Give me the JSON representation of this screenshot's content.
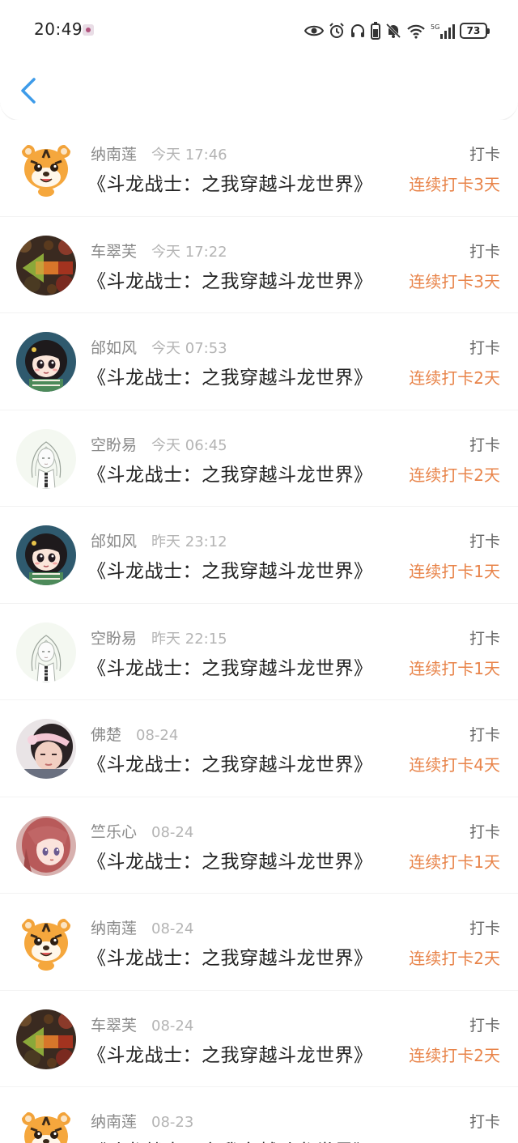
{
  "status": {
    "time": "20:49",
    "battery": "73"
  },
  "header": {
    "back_icon": "chevron-left-icon",
    "accent_color": "#3d9be9"
  },
  "colors": {
    "streak": "#e8844a",
    "name": "#8a8a8a",
    "time": "#b4b4b4",
    "title": "#222222"
  },
  "records": [
    {
      "name": "纳南莲",
      "time": "今天 17:46",
      "book": "《斗龙战士：之我穿越斗龙世界》",
      "type": "打卡",
      "streak": "连续打卡3天",
      "avatar": "tiger"
    },
    {
      "name": "车翠芙",
      "time": "今天 17:22",
      "book": "《斗龙战士：之我穿越斗龙世界》",
      "type": "打卡",
      "streak": "连续打卡3天",
      "avatar": "leaves"
    },
    {
      "name": "邰如风",
      "time": "今天 07:53",
      "book": "《斗龙战士：之我穿越斗龙世界》",
      "type": "打卡",
      "streak": "连续打卡2天",
      "avatar": "girl-dark"
    },
    {
      "name": "空盼易",
      "time": "今天 06:45",
      "book": "《斗龙战士：之我穿越斗龙世界》",
      "type": "打卡",
      "streak": "连续打卡2天",
      "avatar": "sketch-girl"
    },
    {
      "name": "邰如风",
      "time": "昨天 23:12",
      "book": "《斗龙战士：之我穿越斗龙世界》",
      "type": "打卡",
      "streak": "连续打卡1天",
      "avatar": "girl-dark"
    },
    {
      "name": "空盼易",
      "time": "昨天 22:15",
      "book": "《斗龙战士：之我穿越斗龙世界》",
      "type": "打卡",
      "streak": "连续打卡1天",
      "avatar": "sketch-girl"
    },
    {
      "name": "佛楚",
      "time": "08-24",
      "book": "《斗龙战士：之我穿越斗龙世界》",
      "type": "打卡",
      "streak": "连续打卡4天",
      "avatar": "photo-girl"
    },
    {
      "name": "竺乐心",
      "time": "08-24",
      "book": "《斗龙战士：之我穿越斗龙世界》",
      "type": "打卡",
      "streak": "连续打卡1天",
      "avatar": "anime-girl"
    },
    {
      "name": "纳南莲",
      "time": "08-24",
      "book": "《斗龙战士：之我穿越斗龙世界》",
      "type": "打卡",
      "streak": "连续打卡2天",
      "avatar": "tiger"
    },
    {
      "name": "车翠芙",
      "time": "08-24",
      "book": "《斗龙战士：之我穿越斗龙世界》",
      "type": "打卡",
      "streak": "连续打卡2天",
      "avatar": "leaves"
    },
    {
      "name": "纳南莲",
      "time": "08-23",
      "book": "《斗龙战士：之我穿越斗龙世界》",
      "type": "打卡",
      "streak": "",
      "avatar": "tiger"
    }
  ]
}
